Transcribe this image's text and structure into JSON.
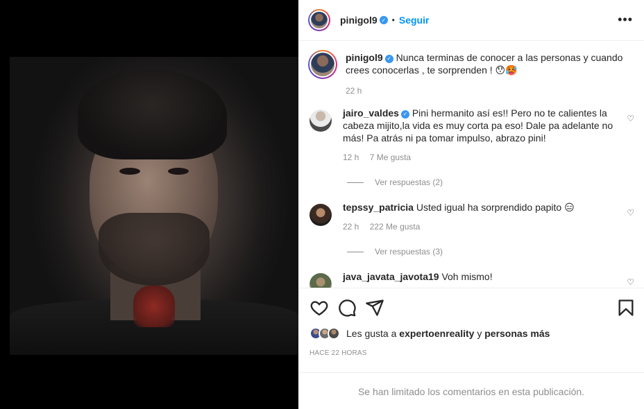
{
  "header": {
    "username": "pinigol9",
    "dot": "•",
    "follow_label": "Seguir",
    "more_label": "•••"
  },
  "caption": {
    "username": "pinigol9",
    "text": "Nunca terminas de conocer a las personas y cuando crees conocerlas , te sorprenden ! 😯🥵",
    "time": "22 h"
  },
  "comments": [
    {
      "username": "jairo_valdes",
      "verified": true,
      "text": "Pini hermanito así es!! Pero no te calientes la cabeza mijito,la vida es muy corta pa eso! Dale pa adelante no más! Pa atrás ni pa tomar impulso, abrazo pini!",
      "time": "12 h",
      "likes": "7 Me gusta",
      "replies": "Ver respuestas (2)"
    },
    {
      "username": "tepssy_patricia",
      "verified": false,
      "text": "Usted igual ha sorprendido papito 😑",
      "time": "22 h",
      "likes": "222 Me gusta",
      "replies": "Ver respuestas (3)"
    },
    {
      "username": "java_javata_javota19",
      "verified": false,
      "text": "Voh mismo!"
    }
  ],
  "actions": {
    "icons": [
      "heart-icon",
      "comment-icon",
      "share-icon",
      "bookmark-icon"
    ],
    "likes_prefix": "Les gusta a",
    "likes_user": "expertoenreality",
    "likes_and": "y",
    "likes_others": "personas más",
    "time_ago": "HACE 22 HORAS",
    "limited_comments": "Se han limitado los comentarios en esta publicación."
  },
  "colors": {
    "link_blue": "#0095f6",
    "verified_blue": "#3897f0",
    "muted_gray": "#8e8e8e",
    "text_dark": "#262626"
  }
}
